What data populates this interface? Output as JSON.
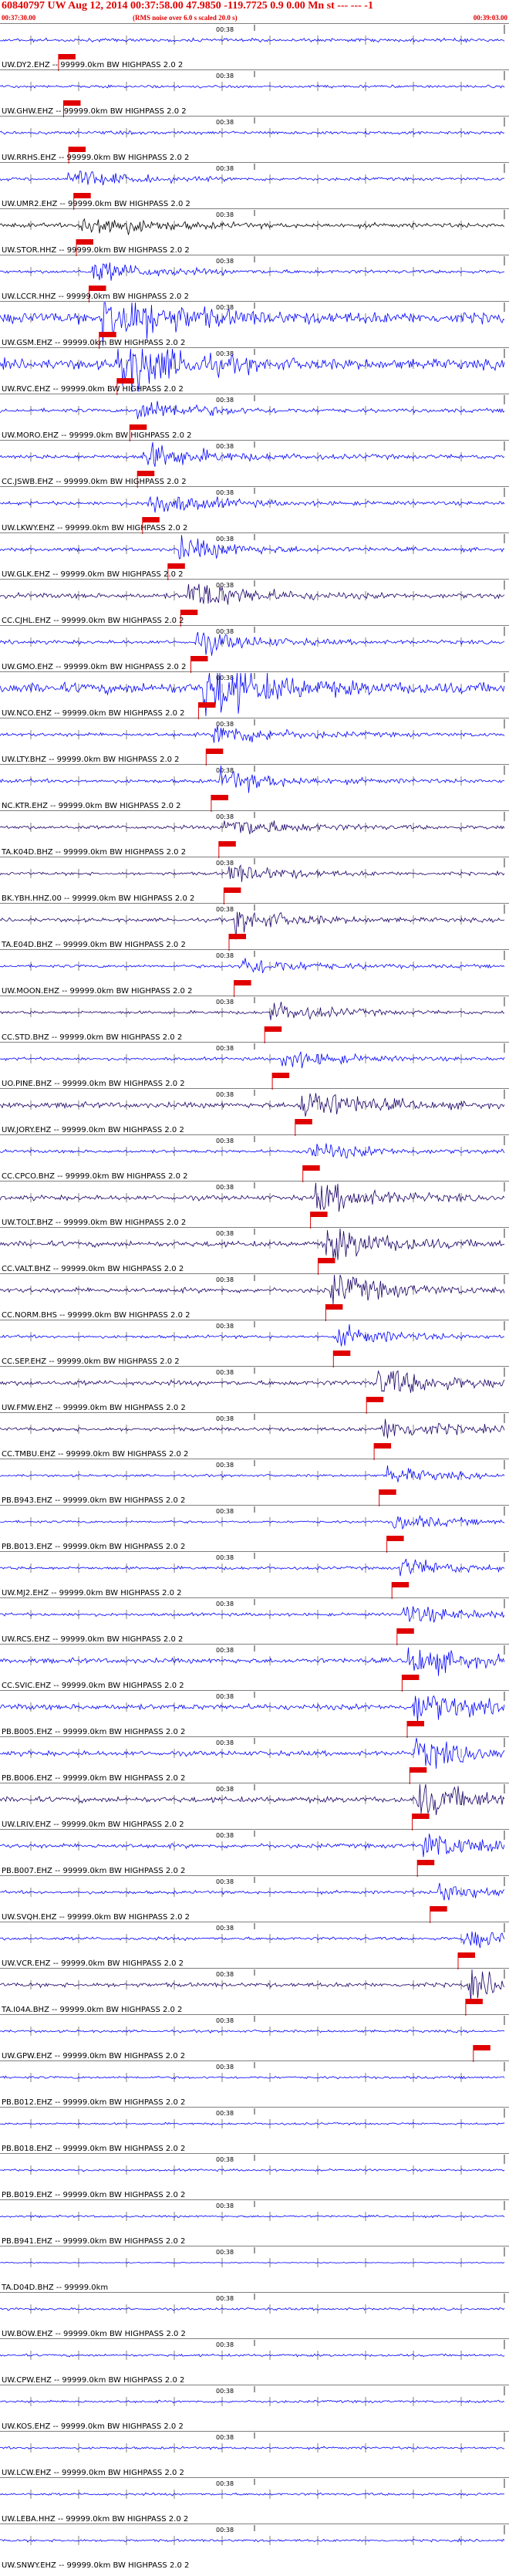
{
  "header": {
    "title": "60840797 UW Aug 12, 2014 00:37:58.00   47.9850 -119.7725  0.9 0.00 Mn st --- --- -1",
    "start_time": "00:37:30.00",
    "rms_note": "(RMS noise over 6.0 s scaled 20.0 s)",
    "end_time": "00:39:03.00"
  },
  "colors": {
    "trace_blue": "#0000ff",
    "trace_dark": "#1a0066",
    "trace_black": "#000000",
    "pick": "#e00000",
    "grid": "#000000"
  },
  "minute_tick_label": "00:38",
  "chart_data": {
    "type": "seismogram-stack",
    "time_range": [
      "00:37:30.00",
      "00:39:03.00"
    ],
    "channels": [
      {
        "label": "UW.DY2.EHZ -- 99999.0km BW  HIGHPASS  2.0  2",
        "pick": 0.115,
        "event": 0.0,
        "amp": 0.55,
        "color": "trace_blue"
      },
      {
        "label": "UW.GHW.EHZ -- 99999.0km BW  HIGHPASS  2.0  2",
        "pick": 0.125,
        "event": 0.0,
        "amp": 0.45,
        "color": "trace_blue"
      },
      {
        "label": "UW.RRHS.EHZ -- 99999.0km BW  HIGHPASS  2.0  2",
        "pick": 0.135,
        "event": 0.0,
        "amp": 0.55,
        "color": "trace_blue"
      },
      {
        "label": "UW.UMR2.EHZ -- 99999.0km BW  HIGHPASS  2.0  2",
        "pick": 0.145,
        "event": 0.13,
        "amp": 0.5,
        "color": "trace_blue"
      },
      {
        "label": "UW.STOR.HHZ -- 99999.0km BW  HIGHPASS  2.0  2",
        "pick": 0.15,
        "event": 0.16,
        "amp": 0.7,
        "color": "trace_black"
      },
      {
        "label": "UW.LCCR.HHZ -- 99999.0km BW  HIGHPASS  2.0  2",
        "pick": 0.175,
        "event": 0.18,
        "amp": 0.55,
        "color": "trace_blue"
      },
      {
        "label": "UW.GSM.EHZ -- 99999.0km BW  HIGHPASS  2.0  2",
        "pick": 0.195,
        "event": 0.2,
        "amp": 1.8,
        "color": "trace_blue"
      },
      {
        "label": "UW.RVC.EHZ -- 99999.0km BW  HIGHPASS  2.0  2",
        "pick": 0.23,
        "event": 0.23,
        "amp": 1.6,
        "color": "trace_blue"
      },
      {
        "label": "UW.MORO.EHZ -- 99999.0km BW  HIGHPASS  2.0  2",
        "pick": 0.255,
        "event": 0.27,
        "amp": 0.6,
        "color": "trace_blue"
      },
      {
        "label": "CC.JSWB.EHZ -- 99999.0km BW  HIGHPASS  2.0  2",
        "pick": 0.27,
        "event": 0.28,
        "amp": 0.7,
        "color": "trace_blue"
      },
      {
        "label": "UW.LKWY.EHZ -- 99999.0km BW  HIGHPASS  2.0  2",
        "pick": 0.28,
        "event": 0.29,
        "amp": 0.6,
        "color": "trace_blue"
      },
      {
        "label": "UW.GLK.EHZ -- 99999.0km BW  HIGHPASS  2.0  2",
        "pick": 0.33,
        "event": 0.35,
        "amp": 0.6,
        "color": "trace_blue"
      },
      {
        "label": "CC.CJHL.EHZ -- 99999.0km BW  HIGHPASS  2.0  2",
        "pick": 0.355,
        "event": 0.37,
        "amp": 0.8,
        "color": "trace_dark"
      },
      {
        "label": "UW.GMO.EHZ -- 99999.0km BW  HIGHPASS  2.0  2",
        "pick": 0.375,
        "event": 0.38,
        "amp": 0.6,
        "color": "trace_blue"
      },
      {
        "label": "UW.NCO.EHZ -- 99999.0km BW  HIGHPASS  2.0  2",
        "pick": 0.39,
        "event": 0.4,
        "amp": 1.7,
        "color": "trace_blue"
      },
      {
        "label": "UW.LTY.BHZ -- 99999.0km BW  HIGHPASS  2.0  2",
        "pick": 0.405,
        "event": 0.42,
        "amp": 0.6,
        "color": "trace_blue"
      },
      {
        "label": "NC.KTR.EHZ -- 99999.0km BW  HIGHPASS  2.0  2",
        "pick": 0.415,
        "event": 0.43,
        "amp": 0.6,
        "color": "trace_blue"
      },
      {
        "label": "TA.K04D.BHZ -- 99999.0km BW  HIGHPASS  2.0  2",
        "pick": 0.43,
        "event": 0.44,
        "amp": 0.6,
        "color": "trace_dark"
      },
      {
        "label": "BK.YBH.HHZ.00 -- 99999.0km BW  HIGHPASS  2.0  2",
        "pick": 0.44,
        "event": 0.45,
        "amp": 0.5,
        "color": "trace_dark"
      },
      {
        "label": "TA.E04D.BHZ -- 99999.0km BW  HIGHPASS  2.0  2",
        "pick": 0.45,
        "event": 0.46,
        "amp": 0.6,
        "color": "trace_dark"
      },
      {
        "label": "UW.MOON.EHZ -- 99999.0km BW  HIGHPASS  2.0  2",
        "pick": 0.46,
        "event": 0.47,
        "amp": 0.5,
        "color": "trace_blue"
      },
      {
        "label": "CC.STD.BHZ -- 99999.0km BW  HIGHPASS  2.0  2",
        "pick": 0.52,
        "event": 0.53,
        "amp": 0.5,
        "color": "trace_dark"
      },
      {
        "label": "UO.PINE.BHZ -- 99999.0km BW  HIGHPASS  2.0  2",
        "pick": 0.535,
        "event": 0.55,
        "amp": 0.5,
        "color": "trace_blue"
      },
      {
        "label": "UW.JORY.EHZ -- 99999.0km BW  HIGHPASS  2.0  2",
        "pick": 0.58,
        "event": 0.59,
        "amp": 0.9,
        "color": "trace_dark"
      },
      {
        "label": "CC.CPCO.BHZ -- 99999.0km BW  HIGHPASS  2.0  2",
        "pick": 0.595,
        "event": 0.6,
        "amp": 0.5,
        "color": "trace_blue"
      },
      {
        "label": "UW.TOLT.BHZ -- 99999.0km BW  HIGHPASS  2.0  2",
        "pick": 0.61,
        "event": 0.62,
        "amp": 0.8,
        "color": "trace_dark"
      },
      {
        "label": "CC.VALT.BHZ -- 99999.0km BW  HIGHPASS  2.0  2",
        "pick": 0.625,
        "event": 0.64,
        "amp": 0.9,
        "color": "trace_dark"
      },
      {
        "label": "CC.NORM.BHS -- 99999.0km BW  HIGHPASS  2.0  2",
        "pick": 0.64,
        "event": 0.65,
        "amp": 0.8,
        "color": "trace_dark"
      },
      {
        "label": "CC.SEP.EHZ -- 99999.0km BW  HIGHPASS  2.0  2",
        "pick": 0.655,
        "event": 0.66,
        "amp": 0.5,
        "color": "trace_blue"
      },
      {
        "label": "UW.FMW.EHZ -- 99999.0km BW  HIGHPASS  2.0  2",
        "pick": 0.72,
        "event": 0.74,
        "amp": 0.8,
        "color": "trace_dark"
      },
      {
        "label": "CC.TMBU.EHZ -- 99999.0km BW  HIGHPASS  2.0  2",
        "pick": 0.735,
        "event": 0.75,
        "amp": 0.6,
        "color": "trace_dark"
      },
      {
        "label": "PB.B943.EHZ -- 99999.0km BW  HIGHPASS  2.0  2",
        "pick": 0.745,
        "event": 0.76,
        "amp": 0.4,
        "color": "trace_blue"
      },
      {
        "label": "PB.B013.EHZ -- 99999.0km BW  HIGHPASS  2.0  2",
        "pick": 0.76,
        "event": 0.77,
        "amp": 0.4,
        "color": "trace_blue"
      },
      {
        "label": "UW.MJ2.EHZ -- 99999.0km BW  HIGHPASS  2.0  2",
        "pick": 0.77,
        "event": 0.78,
        "amp": 0.5,
        "color": "trace_blue"
      },
      {
        "label": "UW.RCS.EHZ -- 99999.0km BW  HIGHPASS  2.0  2",
        "pick": 0.78,
        "event": 0.79,
        "amp": 0.5,
        "color": "trace_blue"
      },
      {
        "label": "CC.SVIC.EHZ -- 99999.0km BW  HIGHPASS  2.0  2",
        "pick": 0.79,
        "event": 0.8,
        "amp": 0.8,
        "color": "trace_blue"
      },
      {
        "label": "PB.B005.EHZ -- 99999.0km BW  HIGHPASS  2.0  2",
        "pick": 0.8,
        "event": 0.81,
        "amp": 0.9,
        "color": "trace_blue"
      },
      {
        "label": "PB.B006.EHZ -- 99999.0km BW  HIGHPASS  2.0  2",
        "pick": 0.805,
        "event": 0.815,
        "amp": 0.8,
        "color": "trace_blue"
      },
      {
        "label": "UW.LRIV.EHZ -- 99999.0km BW  HIGHPASS  2.0  2",
        "pick": 0.81,
        "event": 0.82,
        "amp": 0.9,
        "color": "trace_dark"
      },
      {
        "label": "PB.B007.EHZ -- 99999.0km BW  HIGHPASS  2.0  2",
        "pick": 0.82,
        "event": 0.83,
        "amp": 0.7,
        "color": "trace_blue"
      },
      {
        "label": "UW.SVQH.EHZ -- 99999.0km BW  HIGHPASS  2.0  2",
        "pick": 0.845,
        "event": 0.86,
        "amp": 0.5,
        "color": "trace_blue"
      },
      {
        "label": "UW.VCR.EHZ -- 99999.0km BW  HIGHPASS  2.0  2",
        "pick": 0.9,
        "event": 0.91,
        "amp": 0.5,
        "color": "trace_blue"
      },
      {
        "label": "TA.I04A.BHZ -- 99999.0km BW  HIGHPASS  2.0  2",
        "pick": 0.915,
        "event": 0.92,
        "amp": 0.7,
        "color": "trace_dark"
      },
      {
        "label": "UW.GPW.EHZ -- 99999.0km BW  HIGHPASS  2.0  2",
        "pick": 0.93,
        "event": 0.0,
        "amp": 0.4,
        "color": "trace_blue"
      },
      {
        "label": "PB.B012.EHZ -- 99999.0km BW  HIGHPASS  2.0  2",
        "pick": -1,
        "event": 0.0,
        "amp": 0.4,
        "color": "trace_blue"
      },
      {
        "label": "PB.B018.EHZ -- 99999.0km BW  HIGHPASS  2.0  2",
        "pick": -1,
        "event": 0.0,
        "amp": 0.35,
        "color": "trace_blue"
      },
      {
        "label": "PB.B019.EHZ -- 99999.0km BW  HIGHPASS  2.0  2",
        "pick": -1,
        "event": 0.0,
        "amp": 0.35,
        "color": "trace_blue"
      },
      {
        "label": "PB.B941.EHZ -- 99999.0km BW  HIGHPASS  2.0  2",
        "pick": -1,
        "event": 0.0,
        "amp": 0.35,
        "color": "trace_blue"
      },
      {
        "label": "TA.D04D.BHZ -- 99999.0km",
        "pick": -1,
        "event": 0.0,
        "amp": 0.15,
        "color": "trace_blue"
      },
      {
        "label": "UW.BOW.EHZ -- 99999.0km BW  HIGHPASS  2.0  2",
        "pick": -1,
        "event": 0.0,
        "amp": 0.4,
        "color": "trace_blue"
      },
      {
        "label": "UW.CPW.EHZ -- 99999.0km BW  HIGHPASS  2.0  2",
        "pick": -1,
        "event": 0.0,
        "amp": 0.4,
        "color": "trace_blue"
      },
      {
        "label": "UW.KOS.EHZ -- 99999.0km BW  HIGHPASS  2.0  2",
        "pick": -1,
        "event": 0.0,
        "amp": 0.4,
        "color": "trace_blue"
      },
      {
        "label": "UW.LCW.EHZ -- 99999.0km BW  HIGHPASS  2.0  2",
        "pick": -1,
        "event": 0.0,
        "amp": 0.4,
        "color": "trace_blue"
      },
      {
        "label": "UW.LEBA.HHZ -- 99999.0km BW  HIGHPASS  2.0  2",
        "pick": -1,
        "event": 0.0,
        "amp": 0.4,
        "color": "trace_blue"
      },
      {
        "label": "UW.SNWY.EHZ -- 99999.0km BW  HIGHPASS  2.0  2",
        "pick": -1,
        "event": 0.0,
        "amp": 0.4,
        "color": "trace_blue"
      }
    ]
  }
}
